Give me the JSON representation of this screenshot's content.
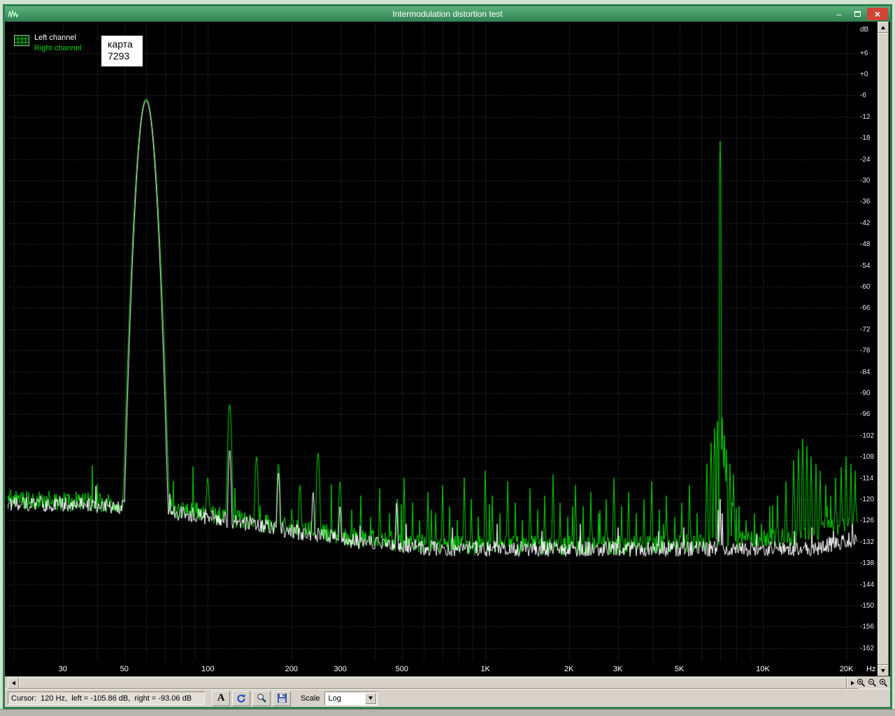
{
  "window": {
    "title": "Intermodulation distortion test",
    "minimize_label": "–",
    "close_label": "×"
  },
  "legend": {
    "left_channel": "Left channel",
    "right_channel": "Right channel"
  },
  "overlay_note": {
    "line1": "карта",
    "line2": "7293"
  },
  "status_bar": {
    "cursor_text": "Cursor:  120 Hz,  left = -105.86 dB,  right = -93.06 dB",
    "font_button": "A",
    "scale_label": "Scale",
    "scale_value": "Log"
  },
  "icons": {
    "titlebar_app": "waveform-icon",
    "legend": "grid-table-icon",
    "toolbar": [
      "font-a-icon",
      "refresh-icon",
      "magnifier-tool-icon",
      "floppy-save-icon"
    ],
    "bottom_right": [
      "zoom-in-icon",
      "zoom-out-icon",
      "zoom-select-icon"
    ]
  },
  "colors": {
    "left_channel": "#ffffff",
    "right_channel": "#00d800",
    "plot_bg": "#000000",
    "grid": "#4a4a4a",
    "titlebar_green": "#3f9563",
    "close_red": "#cf4536",
    "desktop_bg": "#cfe3cf",
    "chrome_bg": "#d6d2c9"
  },
  "axis": {
    "y_unit": "dB",
    "y_ticks": [
      {
        "v": 6,
        "label": "+6"
      },
      {
        "v": 0,
        "label": "+0"
      },
      {
        "v": -6,
        "label": "-6"
      },
      {
        "v": -12,
        "label": "-12"
      },
      {
        "v": -18,
        "label": "-18"
      },
      {
        "v": -24,
        "label": "-24"
      },
      {
        "v": -30,
        "label": "-30"
      },
      {
        "v": -36,
        "label": "-36"
      },
      {
        "v": -42,
        "label": "-42"
      },
      {
        "v": -48,
        "label": "-48"
      },
      {
        "v": -54,
        "label": "-54"
      },
      {
        "v": -60,
        "label": "-60"
      },
      {
        "v": -66,
        "label": "-66"
      },
      {
        "v": -72,
        "label": "-72"
      },
      {
        "v": -78,
        "label": "-78"
      },
      {
        "v": -84,
        "label": "-84"
      },
      {
        "v": -90,
        "label": "-90"
      },
      {
        "v": -96,
        "label": "-96"
      },
      {
        "v": -102,
        "label": "-102"
      },
      {
        "v": -108,
        "label": "-108"
      },
      {
        "v": -114,
        "label": "-114"
      },
      {
        "v": -120,
        "label": "-120"
      },
      {
        "v": -126,
        "label": "-126"
      },
      {
        "v": -132,
        "label": "-132"
      },
      {
        "v": -138,
        "label": "-138"
      },
      {
        "v": -144,
        "label": "-144"
      },
      {
        "v": -150,
        "label": "-150"
      },
      {
        "v": -156,
        "label": "-156"
      },
      {
        "v": -162,
        "label": "-162"
      }
    ],
    "x_ticks": [
      {
        "f": 30,
        "label": "30"
      },
      {
        "f": 50,
        "label": "50"
      },
      {
        "f": 100,
        "label": "100"
      },
      {
        "f": 200,
        "label": "200"
      },
      {
        "f": 300,
        "label": "300"
      },
      {
        "f": 500,
        "label": "500"
      },
      {
        "f": 1000,
        "label": "1K"
      },
      {
        "f": 2000,
        "label": "2K"
      },
      {
        "f": 3000,
        "label": "3K"
      },
      {
        "f": 5000,
        "label": "5K"
      },
      {
        "f": 10000,
        "label": "10K"
      },
      {
        "f": 20000,
        "label": "20K"
      }
    ],
    "x_unit": "Hz"
  },
  "chart_data": {
    "type": "line",
    "title": "Intermodulation distortion test",
    "x_scale": "log",
    "xlabel": "Hz",
    "ylabel": "dB",
    "xlim_hz": [
      19,
      22000
    ],
    "ylim_db": [
      14,
      -166
    ],
    "grid_db_step": 6,
    "x_grid_hz": [
      20,
      30,
      40,
      50,
      60,
      70,
      80,
      90,
      100,
      200,
      300,
      400,
      500,
      600,
      700,
      800,
      900,
      1000,
      2000,
      3000,
      4000,
      5000,
      6000,
      7000,
      8000,
      9000,
      10000,
      20000
    ],
    "cursor": {
      "freq_hz": 120,
      "left_db": -105.86,
      "right_db": -93.06
    },
    "series": [
      {
        "name": "Right channel",
        "color": "#00d800",
        "seed": 20240601,
        "jitter_db": 2.8,
        "random_spike_prob": 0.025,
        "random_spike_db": 12,
        "floor_db": [
          [
            19,
            -120
          ],
          [
            45,
            -121
          ],
          [
            80,
            -123
          ],
          [
            120,
            -125
          ],
          [
            200,
            -128
          ],
          [
            350,
            -131
          ],
          [
            700,
            -133
          ],
          [
            3000,
            -133
          ],
          [
            8000,
            -132
          ],
          [
            15000,
            -130
          ],
          [
            22000,
            -126
          ]
        ],
        "peaks": [
          {
            "f": 60,
            "db": -7,
            "w": 0.055
          },
          {
            "f": 100,
            "db": -114,
            "w": 0.015
          },
          {
            "f": 120,
            "db": -93.06,
            "w": 0.015
          },
          {
            "f": 150,
            "db": -108,
            "w": 0.014
          },
          {
            "f": 180,
            "db": -110,
            "w": 0.014
          },
          {
            "f": 215,
            "db": -116,
            "w": 0.013
          },
          {
            "f": 250,
            "db": -107,
            "w": 0.014
          },
          {
            "f": 300,
            "db": -115,
            "w": 0.013
          }
        ],
        "spikes": [
          [
            330,
            -123
          ],
          [
            355,
            -119
          ],
          [
            385,
            -125
          ],
          [
            415,
            -117
          ],
          [
            450,
            -124
          ],
          [
            480,
            -120
          ],
          [
            510,
            -114
          ],
          [
            545,
            -121
          ],
          [
            580,
            -126
          ],
          [
            620,
            -118
          ],
          [
            660,
            -124
          ],
          [
            700,
            -116
          ],
          [
            745,
            -122
          ],
          [
            790,
            -126
          ],
          [
            840,
            -114
          ],
          [
            890,
            -120
          ],
          [
            945,
            -125
          ],
          [
            1000,
            -112
          ],
          [
            1060,
            -119
          ],
          [
            1130,
            -124
          ],
          [
            1200,
            -115
          ],
          [
            1280,
            -121
          ],
          [
            1360,
            -126
          ],
          [
            1450,
            -117
          ],
          [
            1540,
            -123
          ],
          [
            1640,
            -119
          ],
          [
            1750,
            -113
          ],
          [
            1860,
            -121
          ],
          [
            1980,
            -125
          ],
          [
            2110,
            -116
          ],
          [
            2250,
            -122
          ],
          [
            2400,
            -118
          ],
          [
            2550,
            -124
          ],
          [
            2720,
            -120
          ],
          [
            2900,
            -114
          ],
          [
            3090,
            -122
          ],
          [
            3290,
            -118
          ],
          [
            3500,
            -124
          ],
          [
            3730,
            -120
          ],
          [
            3970,
            -115
          ],
          [
            4230,
            -123
          ],
          [
            4500,
            -119
          ],
          [
            4800,
            -125
          ],
          [
            5110,
            -121
          ],
          [
            5440,
            -116
          ],
          [
            5800,
            -124
          ],
          [
            6300,
            -110
          ],
          [
            6500,
            -104
          ],
          [
            6680,
            -100
          ],
          [
            6850,
            -98
          ],
          [
            7000,
            -19
          ],
          [
            7120,
            -97
          ],
          [
            7250,
            -102
          ],
          [
            7400,
            -106
          ],
          [
            7600,
            -110
          ],
          [
            7850,
            -113
          ],
          [
            8200,
            -122
          ],
          [
            8700,
            -126
          ],
          [
            9300,
            -124
          ],
          [
            9900,
            -127
          ],
          [
            10600,
            -122
          ],
          [
            11300,
            -119
          ],
          [
            12100,
            -115
          ],
          [
            12900,
            -109
          ],
          [
            13400,
            -106
          ],
          [
            13900,
            -103
          ],
          [
            14400,
            -105
          ],
          [
            14900,
            -108
          ],
          [
            15500,
            -110
          ],
          [
            16100,
            -112
          ],
          [
            16800,
            -116
          ],
          [
            17500,
            -119
          ],
          [
            18300,
            -114
          ],
          [
            19100,
            -111
          ],
          [
            19900,
            -108
          ],
          [
            20700,
            -110
          ],
          [
            21500,
            -112
          ]
        ]
      },
      {
        "name": "Left channel",
        "color": "#ffffff",
        "seed": 42424242,
        "jitter_db": 2.2,
        "random_spike_prob": 0.008,
        "random_spike_db": 7,
        "floor_db": [
          [
            19,
            -121
          ],
          [
            45,
            -122
          ],
          [
            80,
            -124
          ],
          [
            120,
            -126
          ],
          [
            200,
            -129
          ],
          [
            350,
            -132
          ],
          [
            700,
            -134
          ],
          [
            15000,
            -134
          ],
          [
            22000,
            -131
          ]
        ],
        "peaks": [
          {
            "f": 60,
            "db": -7.5,
            "w": 0.052
          },
          {
            "f": 120,
            "db": -105.86,
            "w": 0.013
          },
          {
            "f": 180,
            "db": -112.5,
            "w": 0.013
          },
          {
            "f": 240,
            "db": -118,
            "w": 0.012
          },
          {
            "f": 300,
            "db": -122,
            "w": 0.012
          },
          {
            "f": 480,
            "db": -121,
            "w": 0.011
          }
        ],
        "spikes": [
          [
            520,
            -127
          ],
          [
            760,
            -128
          ],
          [
            1100,
            -127
          ],
          [
            1600,
            -129
          ],
          [
            2200,
            -127
          ],
          [
            3000,
            -128
          ],
          [
            4200,
            -129
          ],
          [
            5200,
            -128
          ],
          [
            6900,
            -123
          ],
          [
            7000,
            -120
          ],
          [
            7150,
            -124
          ],
          [
            9500,
            -130
          ],
          [
            13000,
            -129
          ],
          [
            15000,
            -128
          ],
          [
            18000,
            -129
          ],
          [
            21000,
            -127
          ]
        ]
      }
    ]
  }
}
